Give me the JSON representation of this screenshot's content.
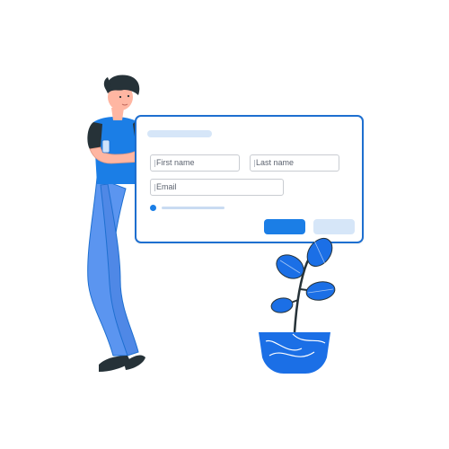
{
  "form": {
    "first_name_placeholder": "First name",
    "last_name_placeholder": "Last name",
    "email_placeholder": "Email"
  },
  "colors": {
    "accent": "#1b7ee6",
    "card_border": "#1e6fd0",
    "light_accent": "#d6e6f8",
    "person_pants": "#5b95f0",
    "plant_leaf": "#1b6fe6"
  },
  "illustration": {
    "person": "man-leaning-on-form",
    "plant": "potted-plant"
  }
}
